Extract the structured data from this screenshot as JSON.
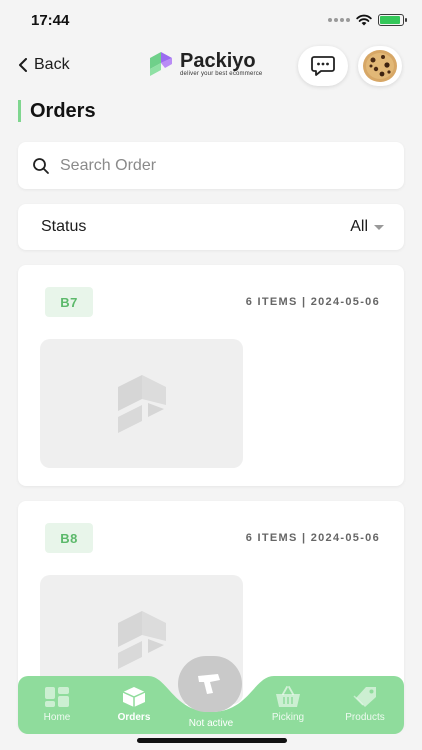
{
  "status_bar": {
    "time": "17:44",
    "battery_level": 0.9
  },
  "header": {
    "back_label": "Back",
    "brand_name": "Packiyo",
    "brand_tagline": "deliver your best ecommerce"
  },
  "page": {
    "title": "Orders"
  },
  "search": {
    "placeholder": "Search Order",
    "value": ""
  },
  "filter": {
    "label": "Status",
    "value": "All"
  },
  "orders": [
    {
      "id": "B7",
      "meta": "6 ITEMS | 2024-05-06"
    },
    {
      "id": "B8",
      "meta": "6 ITEMS | 2024-05-06"
    }
  ],
  "bottom_nav": {
    "items": [
      {
        "label": "Home",
        "icon": "grid-icon"
      },
      {
        "label": "Orders",
        "icon": "box-icon",
        "active": true
      },
      {
        "label": "Not active",
        "icon": "scanner-icon"
      },
      {
        "label": "Picking",
        "icon": "basket-icon"
      },
      {
        "label": "Products",
        "icon": "tag-icon"
      }
    ]
  },
  "colors": {
    "accent": "#7fd68f",
    "nav_background": "#8fdc9c",
    "badge_text": "#5cb96b",
    "badge_bg": "#e8f5ea",
    "background": "#f4f4f4"
  }
}
